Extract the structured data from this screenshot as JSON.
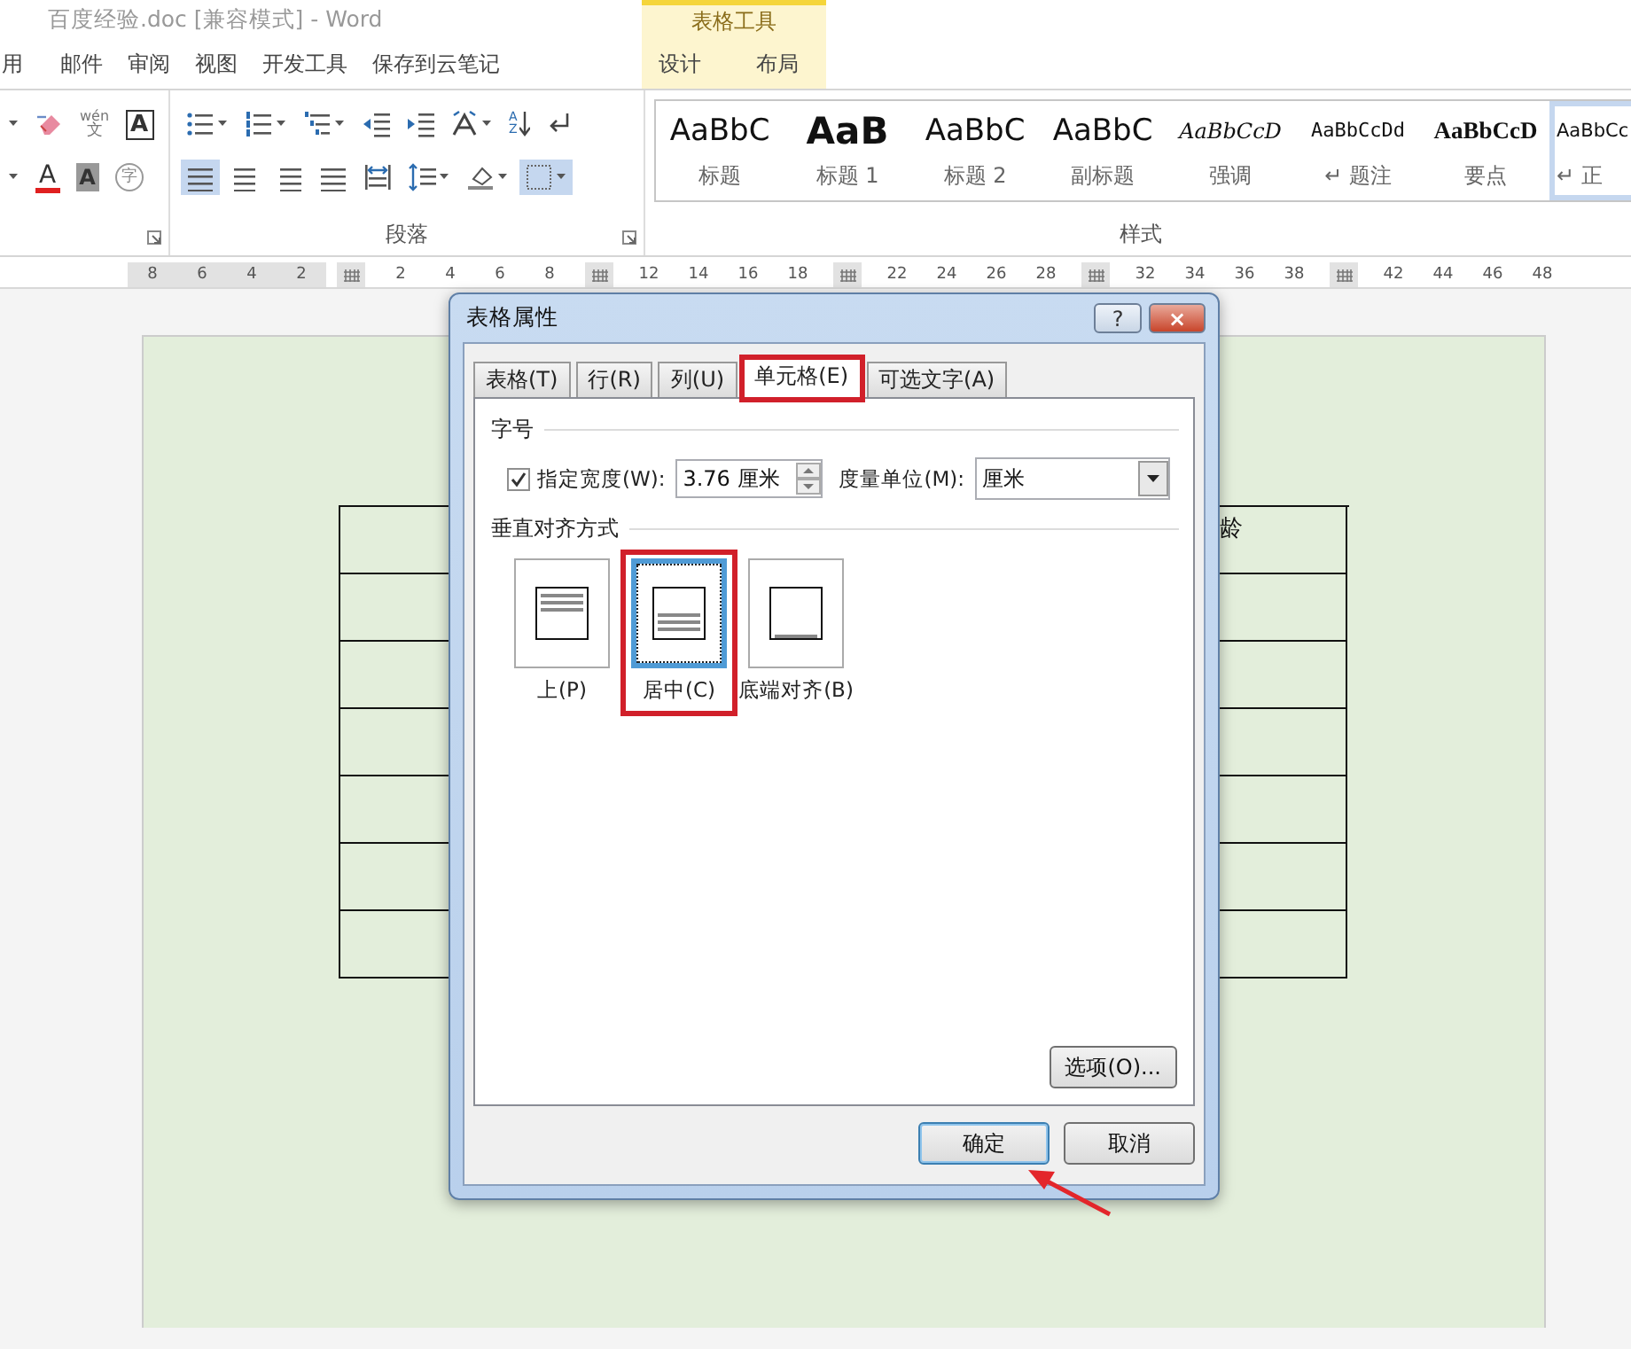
{
  "window": {
    "title": "百度经验.doc [兼容模式] - Word"
  },
  "contextual_group": {
    "title": "表格工具"
  },
  "ribbon_tabs": [
    {
      "label": "用",
      "selected": false,
      "contextual": false
    },
    {
      "label": "邮件",
      "selected": false,
      "contextual": false
    },
    {
      "label": "审阅",
      "selected": false,
      "contextual": false
    },
    {
      "label": "视图",
      "selected": false,
      "contextual": false
    },
    {
      "label": "开发工具",
      "selected": false,
      "contextual": false
    },
    {
      "label": "保存到云笔记",
      "selected": false,
      "contextual": false
    },
    {
      "label": "设计",
      "selected": false,
      "contextual": true
    },
    {
      "label": "布局",
      "selected": false,
      "contextual": true
    }
  ],
  "font_group": {
    "row_1": [
      {
        "kind": "caret"
      },
      {
        "kind": "clear"
      },
      {
        "kind": "phonetic",
        "glyph": "wén",
        "base": "文"
      },
      {
        "kind": "boxed",
        "glyph": "A"
      }
    ],
    "row_2": [
      {
        "kind": "caret"
      },
      {
        "kind": "color",
        "glyph": "A",
        "color": "#e02020"
      },
      {
        "kind": "shaded",
        "glyph": "A"
      },
      {
        "kind": "enclosed",
        "glyph": "字"
      }
    ]
  },
  "paragraph_group": {
    "title": "段落",
    "row_1": [
      {
        "kind": "bullets",
        "selected": false
      },
      {
        "kind": "numbering",
        "selected": false
      },
      {
        "kind": "multilevel",
        "selected": false
      },
      {
        "kind": "outdent",
        "selected": false
      },
      {
        "kind": "indent",
        "selected": false
      },
      {
        "kind": "asian",
        "selected": false
      },
      {
        "kind": "sort",
        "glyph": "AZ",
        "selected": false
      },
      {
        "kind": "marks",
        "selected": false
      }
    ],
    "row_2": [
      {
        "kind": "align-left",
        "selected": true
      },
      {
        "kind": "align-center",
        "selected": false
      },
      {
        "kind": "align-right",
        "selected": false
      },
      {
        "kind": "justify",
        "selected": false
      },
      {
        "kind": "distribute",
        "selected": false
      },
      {
        "kind": "spacing",
        "selected": false
      },
      {
        "kind": "shading",
        "selected": false
      },
      {
        "kind": "borders",
        "selected": true
      }
    ]
  },
  "styles_group": {
    "title": "样式",
    "styles": [
      {
        "sample": "AaBbC",
        "label": "标题",
        "kind": "heading",
        "selected": false
      },
      {
        "sample": "AaB",
        "label": "标题 1",
        "kind": "heading-bold",
        "selected": false
      },
      {
        "sample": "AaBbC",
        "label": "标题 2",
        "kind": "heading",
        "selected": false
      },
      {
        "sample": "AaBbC",
        "label": "副标题",
        "kind": "heading",
        "selected": false
      },
      {
        "sample": "AaBbCcD",
        "label": "强调",
        "kind": "emphasis",
        "selected": false
      },
      {
        "sample": "AaBbCcDd",
        "label": "↵ 题注",
        "kind": "caption",
        "selected": false
      },
      {
        "sample": "AaBbCcD",
        "label": "要点",
        "kind": "strong",
        "selected": false
      },
      {
        "sample": "AaBbCc",
        "label": "↵ 正",
        "kind": "normal",
        "selected": true
      }
    ]
  },
  "ruler": [
    {
      "kind": "margin",
      "label": "8"
    },
    {
      "kind": "margin",
      "label": "6"
    },
    {
      "kind": "margin",
      "label": "4"
    },
    {
      "kind": "margin",
      "label": "2"
    },
    {
      "kind": "marker"
    },
    {
      "kind": "num",
      "label": "2"
    },
    {
      "kind": "num",
      "label": "4"
    },
    {
      "kind": "num",
      "label": "6"
    },
    {
      "kind": "num",
      "label": "8"
    },
    {
      "kind": "marker"
    },
    {
      "kind": "num",
      "label": "12"
    },
    {
      "kind": "num",
      "label": "14"
    },
    {
      "kind": "num",
      "label": "16"
    },
    {
      "kind": "num",
      "label": "18"
    },
    {
      "kind": "marker"
    },
    {
      "kind": "num",
      "label": "22"
    },
    {
      "kind": "num",
      "label": "24"
    },
    {
      "kind": "num",
      "label": "26"
    },
    {
      "kind": "num",
      "label": "28"
    },
    {
      "kind": "marker"
    },
    {
      "kind": "num",
      "label": "32"
    },
    {
      "kind": "num",
      "label": "34"
    },
    {
      "kind": "num",
      "label": "36"
    },
    {
      "kind": "num",
      "label": "38"
    },
    {
      "kind": "marker"
    },
    {
      "kind": "num",
      "label": "42"
    },
    {
      "kind": "num",
      "label": "44"
    },
    {
      "kind": "num",
      "label": "46"
    },
    {
      "kind": "num",
      "label": "48"
    }
  ],
  "document": {
    "table": {
      "rows": [
        {
          "kind": "header",
          "right_text": "龄"
        },
        {
          "kind": "blank"
        },
        {
          "kind": "blank"
        },
        {
          "kind": "blank"
        },
        {
          "kind": "blank"
        },
        {
          "kind": "blank"
        },
        {
          "kind": "blank"
        }
      ]
    }
  },
  "dialog": {
    "title": "表格属性",
    "help": "?",
    "close": "×",
    "tabs": [
      {
        "label": "表格(T)",
        "selected": false,
        "highlighted": false
      },
      {
        "label": "行(R)",
        "selected": false,
        "highlighted": false
      },
      {
        "label": "列(U)",
        "selected": false,
        "highlighted": false
      },
      {
        "label": "单元格(E)",
        "selected": true,
        "highlighted": true
      },
      {
        "label": "可选文字(A)",
        "selected": false,
        "highlighted": false
      }
    ],
    "size_section": {
      "title": "字号",
      "width_checkbox": {
        "label": "指定宽度(W):",
        "checked": true
      },
      "width_value": "3.76 厘米",
      "unit_label": "度量单位(M):",
      "unit_value": "厘米"
    },
    "align_section": {
      "title": "垂直对齐方式",
      "options": [
        {
          "label": "上(P)",
          "kind": "top",
          "selected": false,
          "highlighted": false
        },
        {
          "label": "居中(C)",
          "kind": "center",
          "selected": true,
          "highlighted": true
        },
        {
          "label": "底端对齐(B)",
          "kind": "bottom",
          "selected": false,
          "highlighted": false
        }
      ]
    },
    "options_button": "选项(O)...",
    "buttons": [
      {
        "label": "确定",
        "default": true
      },
      {
        "label": "取消",
        "default": false
      }
    ]
  },
  "annotations": [
    {
      "kind": "arrow"
    }
  ]
}
